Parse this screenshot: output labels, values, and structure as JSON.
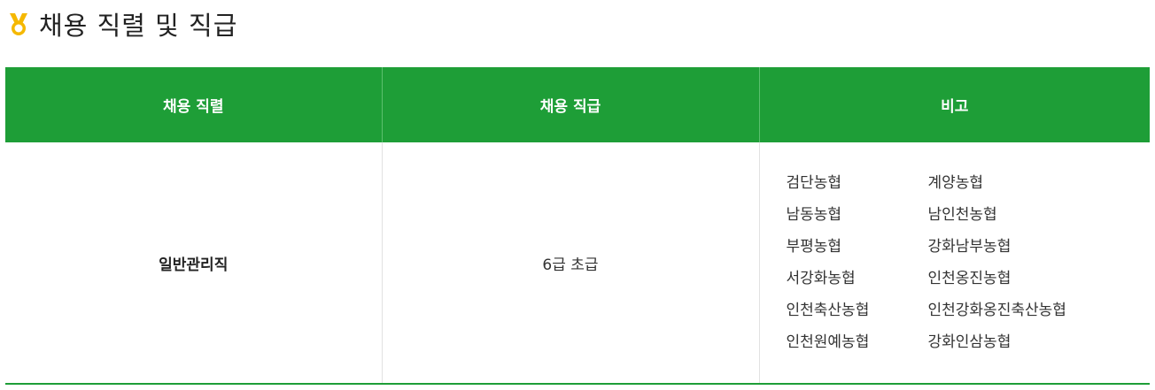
{
  "section": {
    "title": "채용 직렬 및 직급",
    "icon": "medal-icon",
    "accent_color": "#1e9e37",
    "icon_color": "#f5b800"
  },
  "table": {
    "headers": [
      "채용 직렬",
      "채용 직급",
      "비고"
    ],
    "rows": [
      {
        "job_series": "일반관리직",
        "grade": "6급 초급",
        "remarks": [
          [
            "검단농협",
            "계양농협"
          ],
          [
            "남동농협",
            "남인천농협"
          ],
          [
            "부평농협",
            "강화남부농협"
          ],
          [
            "서강화농협",
            "인천옹진농협"
          ],
          [
            "인천축산농협",
            "인천강화옹진축산농협"
          ],
          [
            "인천원예농협",
            "강화인삼농협"
          ]
        ]
      }
    ]
  }
}
